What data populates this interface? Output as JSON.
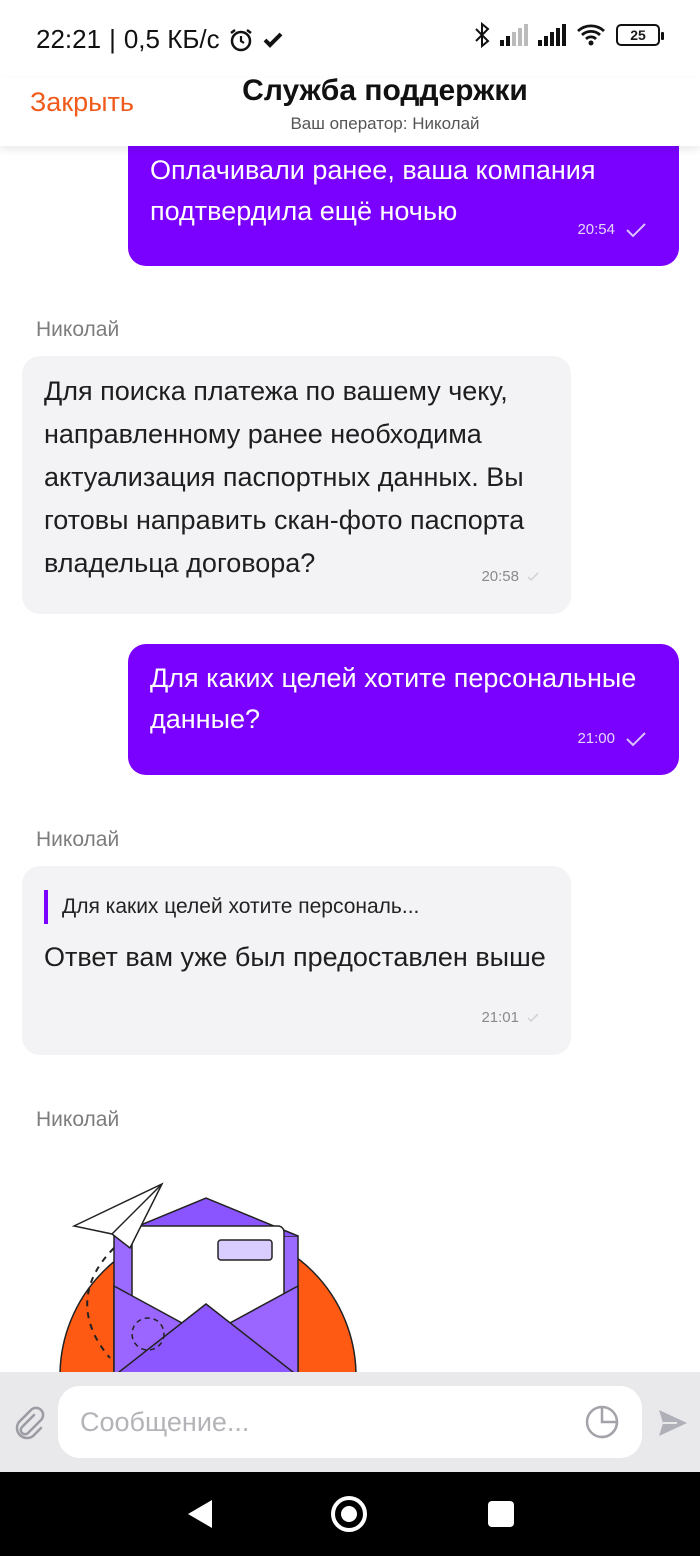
{
  "status_bar": {
    "time": "22:21",
    "separator": "|",
    "network_speed": "0,5 КБ/с",
    "battery_level": "25",
    "icons": [
      "alarm-icon",
      "check-icon",
      "bluetooth-icon",
      "signal-icon",
      "signal-icon",
      "wifi-icon",
      "battery-icon"
    ]
  },
  "header": {
    "close_label": "Закрыть",
    "title": "Служба поддержки",
    "subtitle": "Ваш оператор: Николай",
    "accent_color": "#f05a1a"
  },
  "colors": {
    "outgoing_bubble": "#7a00ff",
    "incoming_bubble": "#f3f3f5"
  },
  "messages": [
    {
      "direction": "out",
      "text": "Оплачивали ранее, ваша компания подтвердила ещё ночью",
      "time": "20:54",
      "status": "read"
    },
    {
      "direction": "in",
      "sender": "Николай",
      "text": "Для поиска платежа по вашему чеку, направленному ранее необходима актуализация паспортных данных. Вы готовы направить скан-фото паспорта владельца договора?",
      "time": "20:58"
    },
    {
      "direction": "out",
      "text": "Для каких целей хотите персональные данные?",
      "time": "21:00",
      "status": "read"
    },
    {
      "direction": "in",
      "sender": "Николай",
      "quote": "Для каких целей хотите персональ...",
      "text": "Ответ вам уже был предоставлен выше",
      "time": "21:01"
    },
    {
      "direction": "in",
      "sender": "Николай",
      "kind": "sticker",
      "sticker_icon": "envelope-paper-plane-illustration"
    }
  ],
  "composer": {
    "placeholder": "Сообщение...",
    "value": ""
  },
  "nav": {
    "icons": [
      "back-icon",
      "home-icon",
      "recent-apps-icon"
    ]
  }
}
